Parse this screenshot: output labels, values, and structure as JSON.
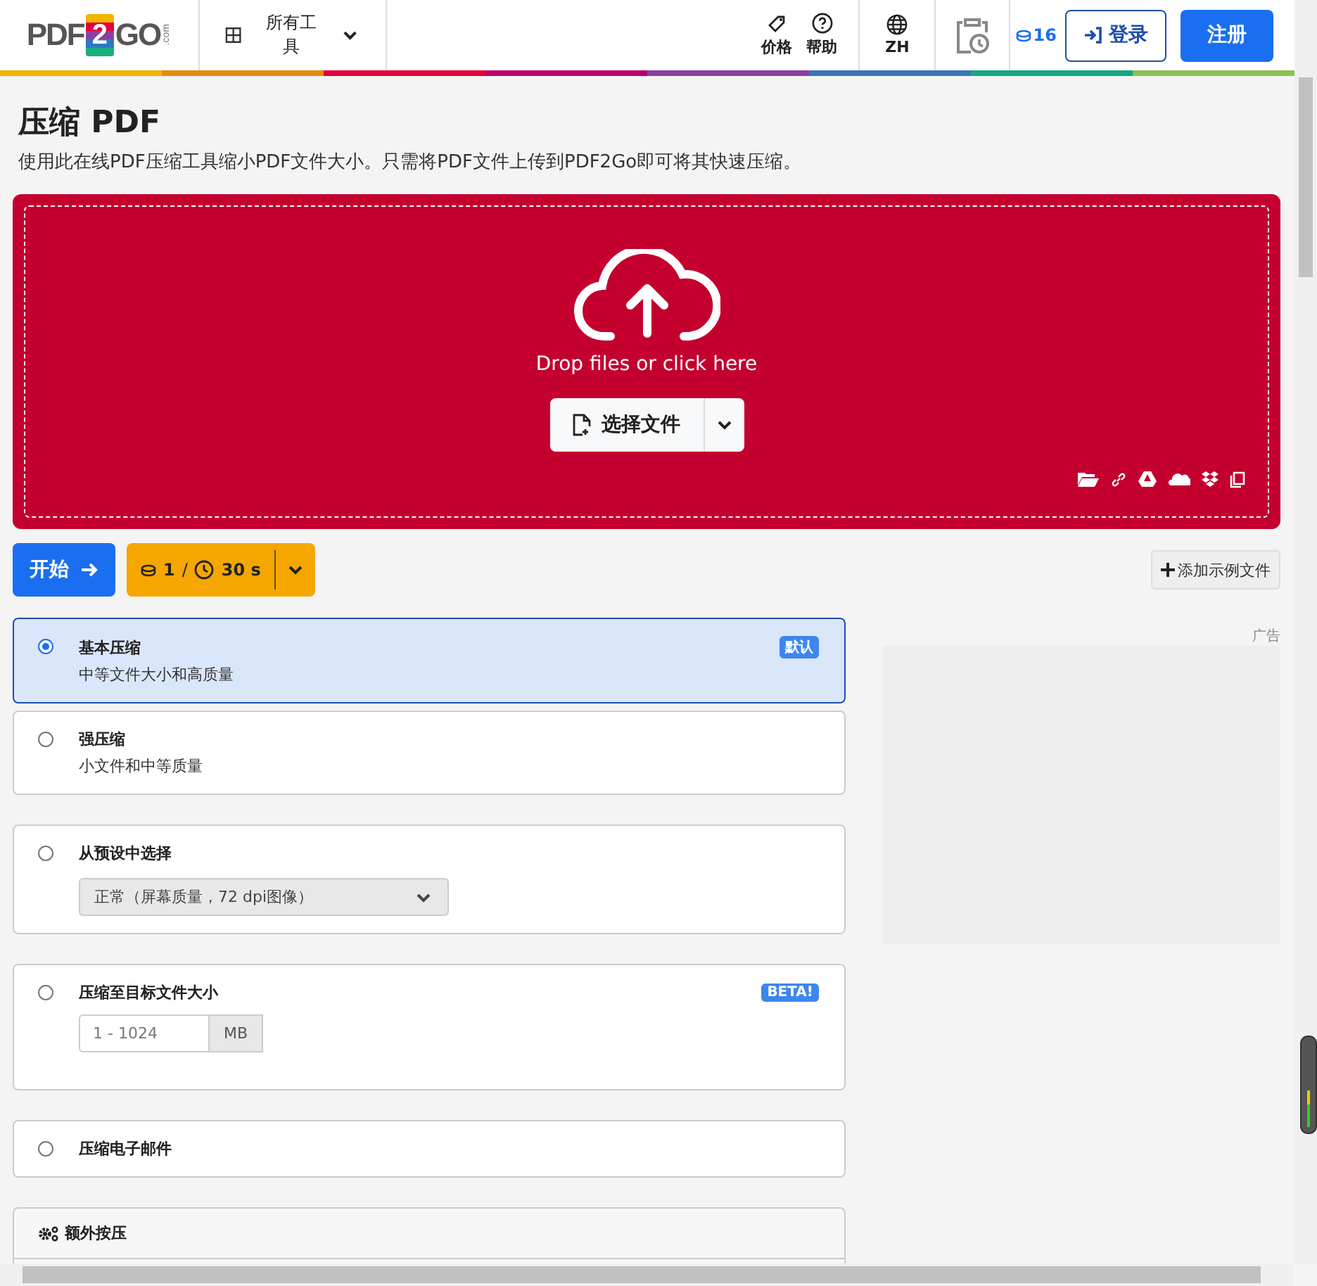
{
  "header": {
    "logo": {
      "left": "PDF",
      "badge": "2",
      "right": "GO",
      "suffix": ".com"
    },
    "tools_menu": {
      "label": "所有工具"
    },
    "nav": [
      {
        "label": "价格",
        "kind": "tag"
      },
      {
        "label": "帮助",
        "kind": "help"
      }
    ],
    "language": "ZH",
    "credits": "16",
    "login": "登录",
    "signup": "注册"
  },
  "page": {
    "title": "压缩 PDF",
    "description": "使用此在线PDF压缩工具缩小PDF文件大小。只需将PDF文件上传到PDF2Go即可将其快速压缩。"
  },
  "upload": {
    "prompt": "Drop files or click here",
    "choose_button": "选择文件"
  },
  "actions": {
    "start": "开始",
    "credits": "1",
    "separator": "/",
    "time": "30 s",
    "sample": "添加示例文件"
  },
  "ad_label": "广告",
  "options": [
    {
      "kind": "simple",
      "title": "基本压缩",
      "subtitle": "中等文件大小和高质量",
      "badge": "默认",
      "selected": true
    },
    {
      "kind": "simple",
      "title": "强压缩",
      "subtitle": "小文件和中等质量",
      "selected": false
    },
    {
      "kind": "preset",
      "title": "从预设中选择",
      "value": "正常（屏幕质量，72 dpi图像）",
      "selected": false
    },
    {
      "kind": "target",
      "title": "压缩至目标文件大小",
      "badge": "BETA!",
      "placeholder": "1 - 1024",
      "unit": "MB",
      "selected": false
    },
    {
      "kind": "plain",
      "title": "压缩电子邮件",
      "selected": false
    }
  ],
  "extra": {
    "title": "额外按压"
  }
}
